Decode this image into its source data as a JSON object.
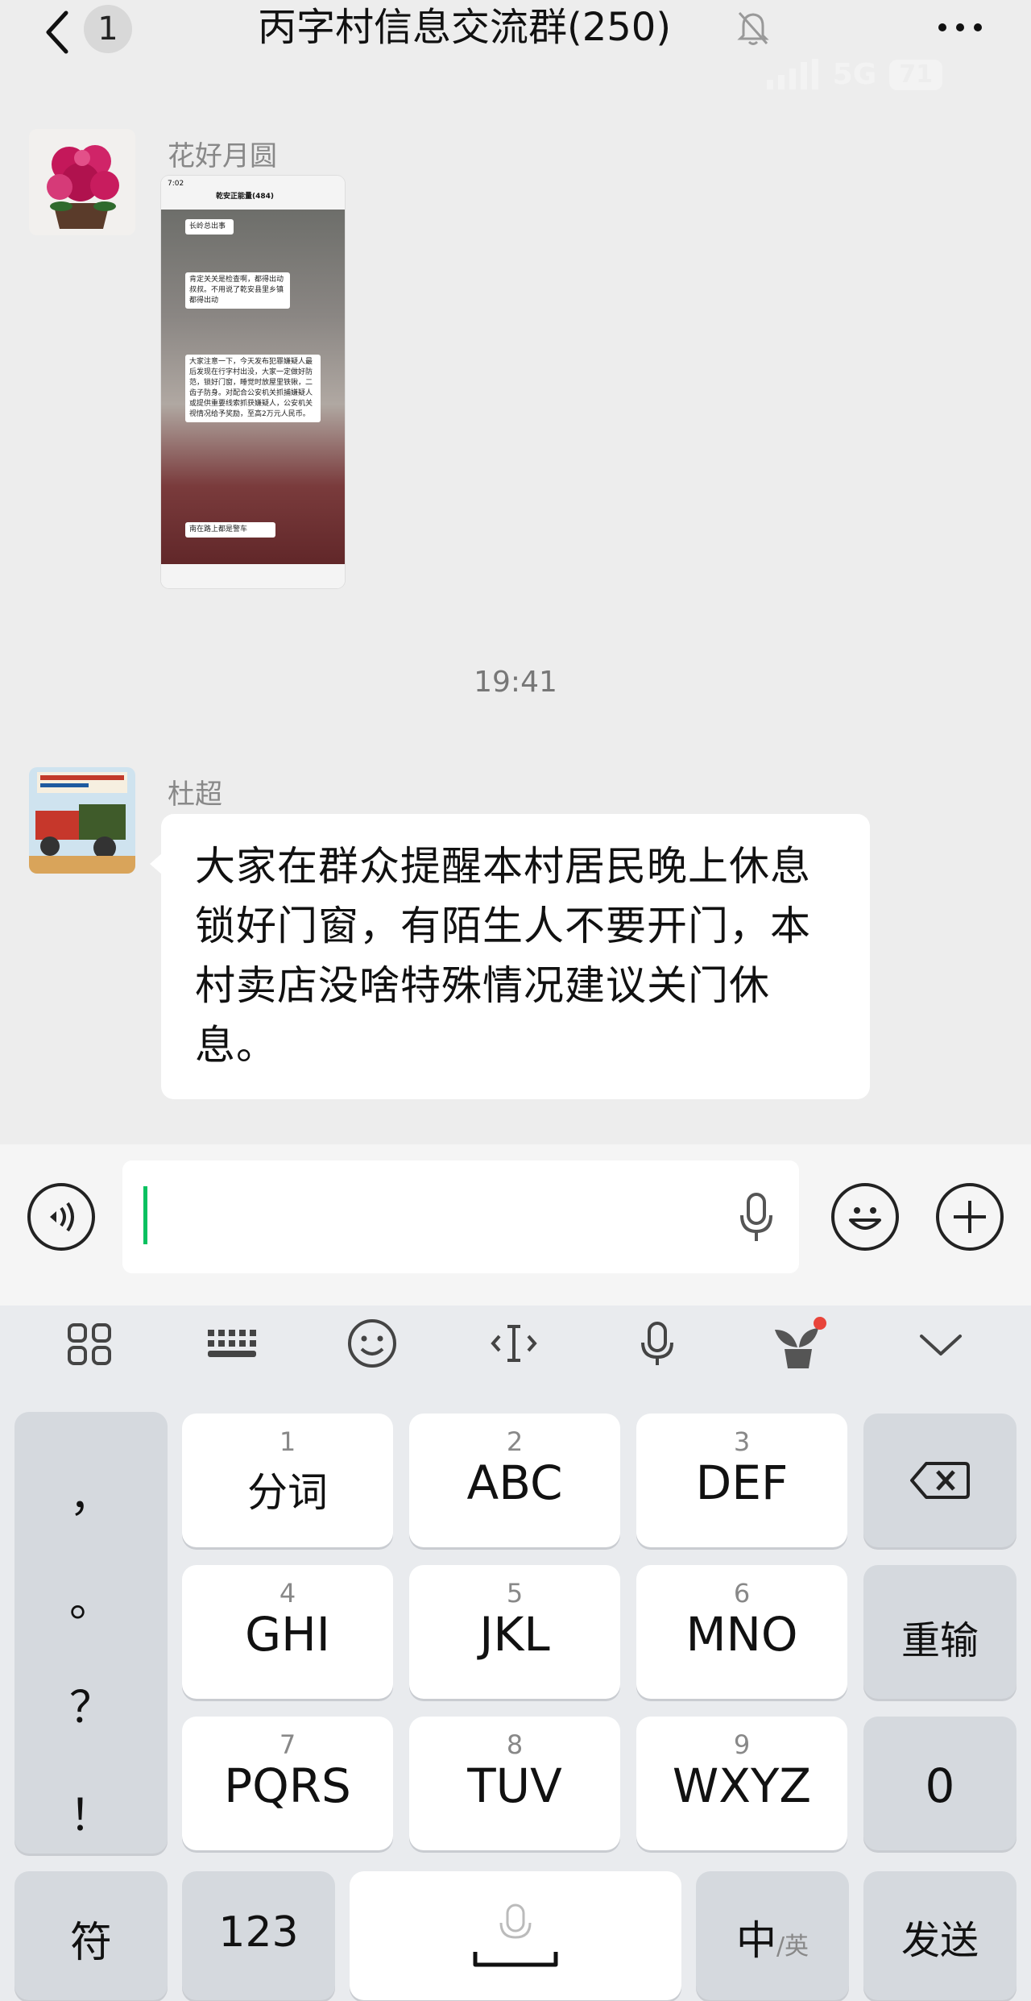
{
  "header": {
    "unread_count": "1",
    "title": "丙字村信息交流群(250)",
    "status": {
      "network": "5G",
      "battery": "71"
    }
  },
  "messages": [
    {
      "sender": "花好月圆",
      "type": "image",
      "screenshot": {
        "time": "7:02",
        "title": "乾安正能量(484)",
        "lines": [
          "长岭总出事",
          "肯定关关是检查啊，都得出动叔叔。不用说了乾安县里乡镇都得出动",
          "大家注意一下，今天发布犯罪嫌疑人最后发现在行字村出没，大家一定做好防范，锁好门窗，睡觉时放屋里铁锹，二齿子防身。对配合公安机关抓捕嫌疑人或提供重要线索抓获嫌疑人，公安机关视情况给予奖励，至高2万元人民币。",
          "南在路上都是警车"
        ]
      }
    },
    {
      "timestamp": "19:41"
    },
    {
      "sender": "杜超",
      "type": "text",
      "text": "大家在群众提醒本村居民晚上休息锁好门窗，有陌生人不要开门，本村卖店没啥特殊情况建议关门休息。"
    }
  ],
  "keyboard": {
    "punct": [
      "，",
      "。",
      "？",
      "！"
    ],
    "keys": [
      {
        "num": "1",
        "label": "分词"
      },
      {
        "num": "2",
        "label": "ABC"
      },
      {
        "num": "3",
        "label": "DEF"
      },
      {
        "num": "4",
        "label": "GHI"
      },
      {
        "num": "5",
        "label": "JKL"
      },
      {
        "num": "6",
        "label": "MNO"
      },
      {
        "num": "7",
        "label": "PQRS"
      },
      {
        "num": "8",
        "label": "TUV"
      },
      {
        "num": "9",
        "label": "WXYZ"
      }
    ],
    "retype": "重输",
    "zero": "0",
    "symbol": "符",
    "numbers": "123",
    "lang_main": "中",
    "lang_alt": "/英",
    "send": "发送"
  },
  "colors": {
    "background": "#ededed",
    "bubble": "#ffffff",
    "caret": "#07c160",
    "keyboard": "#e9ebee"
  },
  "icons": {
    "back": "chevron-left-icon",
    "mute": "bell-off-icon",
    "more": "more-dots-icon",
    "voice": "voice-wave-icon",
    "mic": "microphone-icon",
    "emoji": "smiley-icon",
    "add": "plus-icon",
    "apps": "grid-icon",
    "keyboard": "keyboard-icon",
    "cursor": "cursor-icon",
    "plant": "plant-icon",
    "collapse": "chevron-down-icon",
    "delete": "backspace-icon"
  }
}
